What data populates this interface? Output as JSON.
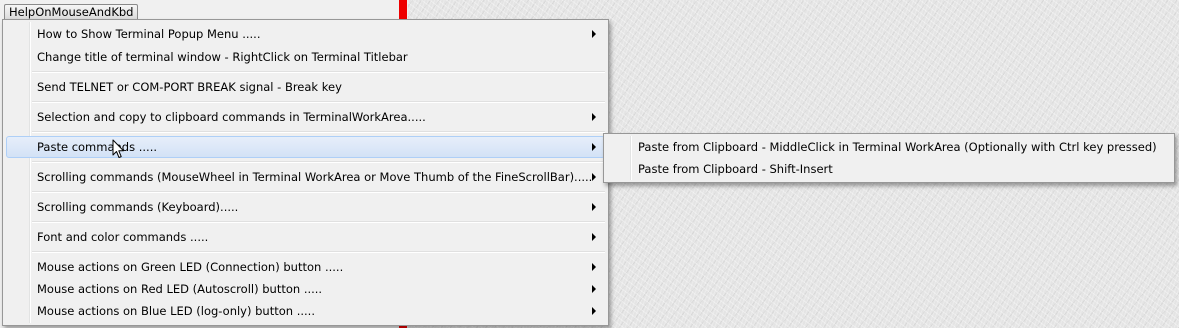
{
  "colors": {
    "accent_red": "#ee0000",
    "highlight": "#d8e6f8"
  },
  "title_button": {
    "label": "HelpOnMouseAndKbd"
  },
  "menu": {
    "items": [
      {
        "label": "How to Show Terminal Popup Menu .....",
        "has_submenu": true
      },
      {
        "label": "Change title of terminal window - RightClick on Terminal Titlebar",
        "has_submenu": false
      },
      {
        "label": "Send TELNET or COM-PORT BREAK signal - Break key",
        "has_submenu": false
      },
      {
        "label": "Selection and copy to clipboard commands in TerminalWorkArea.....",
        "has_submenu": true
      },
      {
        "label": "Paste commands .....",
        "has_submenu": true,
        "highlighted": true
      },
      {
        "label": "Scrolling commands (MouseWheel in Terminal WorkArea or Move Thumb of the FineScrollBar).....",
        "has_submenu": true
      },
      {
        "label": "Scrolling commands (Keyboard).....",
        "has_submenu": true
      },
      {
        "label": "Font and color commands .....",
        "has_submenu": true
      },
      {
        "label": "Mouse actions on Green LED (Connection) button .....",
        "has_submenu": true
      },
      {
        "label": "Mouse actions on Red LED (Autoscroll) button .....",
        "has_submenu": true
      },
      {
        "label": "Mouse actions on Blue LED (log-only) button .....",
        "has_submenu": true
      }
    ]
  },
  "submenu": {
    "items": [
      {
        "label": "Paste from Clipboard - MiddleClick in Terminal WorkArea (Optionally with Ctrl key pressed)"
      },
      {
        "label": "Paste from Clipboard - Shift-Insert"
      }
    ]
  },
  "cursor": {
    "icon": "arrow-pointer-icon"
  }
}
